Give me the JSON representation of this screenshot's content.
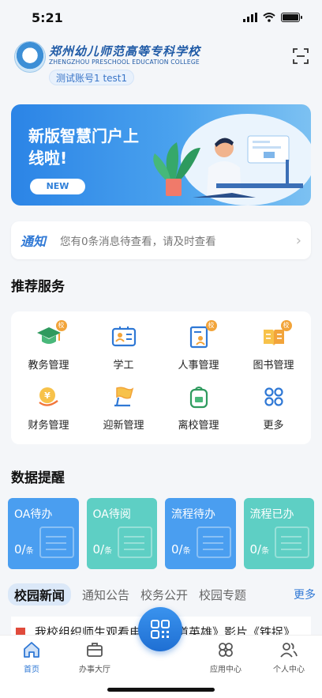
{
  "status_bar": {
    "time": "5:21"
  },
  "header": {
    "school_name_cn": "郑州幼儿师范高等专科学校",
    "school_name_en": "ZHENGZHOU PRESCHOOL EDUCATION COLLEGE",
    "account": "测试账号1 test1"
  },
  "banner": {
    "title": "新版智慧门户上线啦!",
    "badge": "NEW"
  },
  "notice": {
    "tag": "通知",
    "text": "您有0条消息待查看，请及时查看"
  },
  "services": {
    "title": "推荐服务",
    "items": [
      {
        "label": "教务管理",
        "icon": "graduation-cap-icon",
        "badge": "校"
      },
      {
        "label": "学工",
        "icon": "id-card-icon",
        "badge": ""
      },
      {
        "label": "人事管理",
        "icon": "personnel-doc-icon",
        "badge": "校"
      },
      {
        "label": "图书管理",
        "icon": "book-icon",
        "badge": "校"
      },
      {
        "label": "财务管理",
        "icon": "finance-icon",
        "badge": ""
      },
      {
        "label": "迎新管理",
        "icon": "welcome-flag-icon",
        "badge": ""
      },
      {
        "label": "离校管理",
        "icon": "backpack-icon",
        "badge": ""
      },
      {
        "label": "更多",
        "icon": "more-grid-icon",
        "badge": ""
      }
    ]
  },
  "data_reminder": {
    "title": "数据提醒",
    "cards": [
      {
        "label": "OA待办",
        "count": "0",
        "unit": "条",
        "color": "#4a9ef0"
      },
      {
        "label": "OA待阅",
        "count": "0",
        "unit": "条",
        "color": "#5ecfc4"
      },
      {
        "label": "流程待办",
        "count": "0",
        "unit": "条",
        "color": "#4a9ef0"
      },
      {
        "label": "流程已办",
        "count": "0",
        "unit": "条",
        "color": "#5ecfc4"
      }
    ]
  },
  "news": {
    "tabs": [
      "校园新闻",
      "通知公告",
      "校务公开",
      "校园专题"
    ],
    "more": "更多",
    "first_item": "我校组织师生观看电影《铁道英雄》影片《铁捉》"
  },
  "tabbar": {
    "items": [
      {
        "label": "首页",
        "icon": "home-icon"
      },
      {
        "label": "办事大厅",
        "icon": "briefcase-icon"
      },
      {
        "label": "应用中心",
        "icon": "apps-icon"
      },
      {
        "label": "个人中心",
        "icon": "users-icon"
      }
    ]
  },
  "colors": {
    "primary": "#2f78d5",
    "badge": "#f2a43a",
    "teal": "#5ecfc4"
  }
}
